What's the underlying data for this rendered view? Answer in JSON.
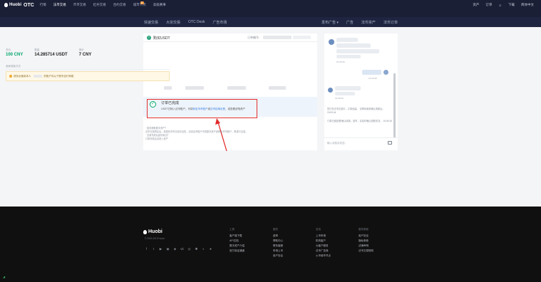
{
  "topbar": {
    "logo": "Huobi",
    "logo_otc": "OTC",
    "nav": [
      "行情",
      "法币交易",
      "币币交易",
      "杠杆交易",
      "合约交易",
      "城市节点",
      "高级赛事"
    ],
    "active_index": 1,
    "hot_badge": "新",
    "right": [
      "资产",
      "订单",
      "",
      "下载",
      "简体中文"
    ]
  },
  "subnav": {
    "left": [
      "快速交易",
      "大宗交易",
      "OTC Desk",
      "广告市场"
    ],
    "right": [
      "发布广告 ▾",
      "广告",
      "法币资产",
      "法币订单"
    ]
  },
  "order": {
    "coin_icon": "T",
    "title": "购买USDT",
    "order_no_label": "订单编号:",
    "stats": [
      {
        "label": "总价",
        "value": "100 CNY",
        "green": true
      },
      {
        "label": "数量",
        "value": "14.285714 USDT",
        "green": false
      },
      {
        "label": "单价",
        "value": "7 CNY",
        "green": false
      }
    ],
    "section_title": "卖家收款方式",
    "warning_pre": "请务必使用本人",
    "warning_post": "的账户向以下账号自行转账",
    "done_title": "订单已完成",
    "done_desc_pre": "USDT已转入法币账户，可将",
    "done_link1": "转至币币账户",
    "done_desc_mid": "或",
    "done_link2": "法币挂单出售",
    "done_desc_post": "，或查看该笔资产",
    "done_check": "✓"
  },
  "notes": [
    "· 如何提取数字资产？",
    "  法币交易购买后，若想在币币交易中出售，请将法币账户中的数字资产划转至币币账户，再进行交易。",
    "· 交易完成后如何卖出？",
    "  订单完成后请进入资产"
  ],
  "chat": {
    "times": [
      "15:05:46",
      "15:05:48",
      "15:05:50"
    ],
    "sys1": "您已在法币交易中，订单创建。 请等待卖家确认收款后，15:05:44",
    "sys2": "订单已被处理/确认收款，放币，请及时确认到账情况。 15:05:48",
    "input_placeholder": "输入消息并发送..."
  },
  "footer": {
    "logo": "Huobi",
    "copyright": "© 2019-2019 Huobi",
    "social_icons": [
      "f",
      "t",
      "▶",
      "◉",
      "◈",
      "vk",
      "◎",
      "✱",
      "◐",
      "●"
    ],
    "columns": [
      {
        "head": "工具",
        "items": [
          "客户端下载",
          "API文档",
          "数字资产介绍",
          "官方验证通道"
        ]
      },
      {
        "head": "服务",
        "items": [
          "费率",
          "帮助中心",
          "联系客服",
          "申请上币",
          "用户协议"
        ]
      },
      {
        "head": "支持",
        "items": [
          "上币申请",
          "机构客户",
          "大客户服务",
          "法币广告商",
          "火币城市节点"
        ]
      },
      {
        "head": "服务条款",
        "items": [
          "用户协议",
          "隐私条款",
          "法律声明",
          "法币交易规则"
        ]
      }
    ]
  },
  "colors": {
    "brand_green": "#03a66d",
    "link": "#357ce1",
    "highlight_red": "#e22d2d"
  }
}
